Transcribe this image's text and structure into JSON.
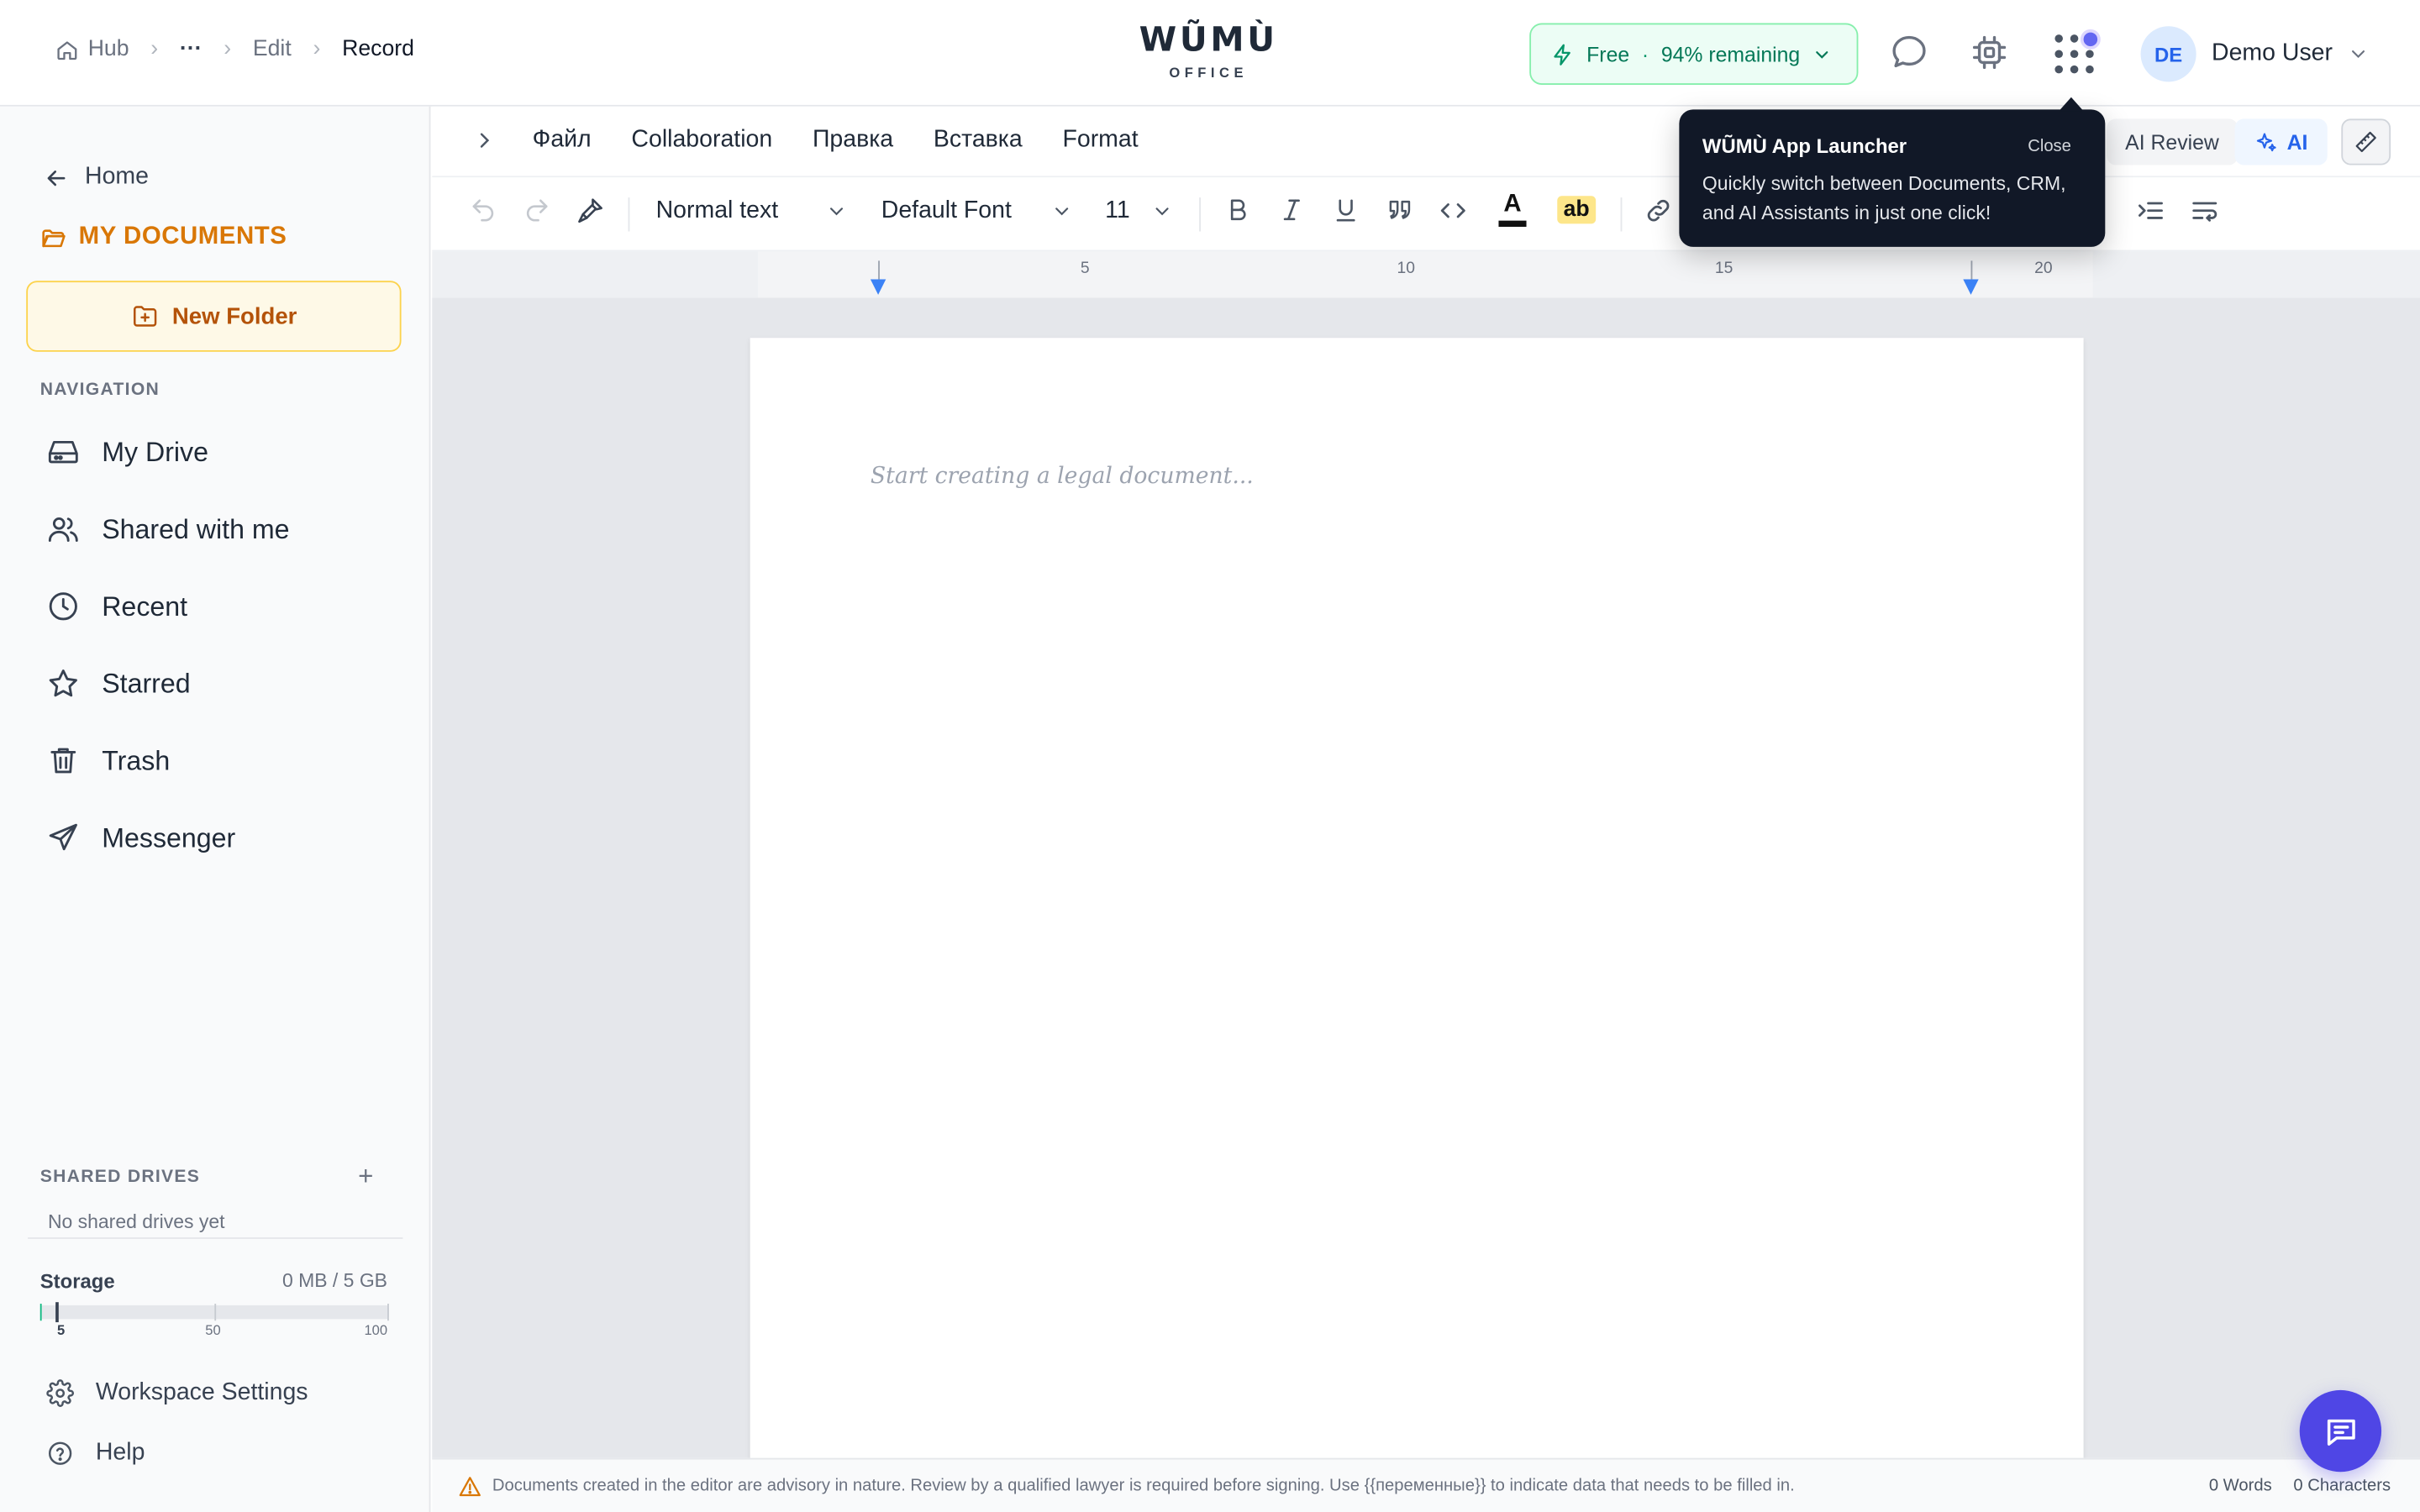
{
  "header": {
    "breadcrumbs": {
      "hub": "Hub",
      "ellipsis": "···",
      "edit": "Edit",
      "current": "Record"
    },
    "logo": {
      "word": "WŨMÙ",
      "sub": "OFFICE"
    },
    "plan": {
      "name": "Free",
      "separator": "·",
      "remaining": "94% remaining"
    },
    "user": {
      "initials": "DE",
      "name": "Demo User"
    },
    "apps_notification_color": "#6366f1"
  },
  "sidebar": {
    "home": "Home",
    "section_title": "MY DOCUMENTS",
    "new_folder": "New Folder",
    "nav_label": "NAVIGATION",
    "nav_items": [
      {
        "label": "My Drive",
        "icon": "drive-icon"
      },
      {
        "label": "Shared with me",
        "icon": "users-icon"
      },
      {
        "label": "Recent",
        "icon": "clock-icon"
      },
      {
        "label": "Starred",
        "icon": "star-icon"
      },
      {
        "label": "Trash",
        "icon": "trash-icon"
      },
      {
        "label": "Messenger",
        "icon": "send-icon"
      }
    ],
    "shared_drives_label": "SHARED DRIVES",
    "shared_drives_add": "+",
    "no_shared": "No shared drives yet",
    "storage": {
      "label": "Storage",
      "value": "0 MB / 5 GB",
      "used_fraction": 0.0,
      "scale": [
        "5",
        "50",
        "100"
      ]
    },
    "workspace_settings": "Workspace Settings",
    "help": "Help"
  },
  "menubar": {
    "items": [
      "Файл",
      "Collaboration",
      "Правка",
      "Вставка",
      "Format"
    ],
    "ai_review": "AI Review",
    "ai": "AI"
  },
  "toolbar": {
    "style": "Normal text",
    "font": "Default Font",
    "size": "11",
    "text_color_glyph": "A",
    "highlight_glyph": "ab"
  },
  "ruler": {
    "labels": [
      "5",
      "10",
      "15",
      "20"
    ]
  },
  "editor": {
    "placeholder": "Start creating a legal document..."
  },
  "popover": {
    "title": "WŨMÙ App Launcher",
    "close": "Close",
    "body": "Quickly switch between Documents, CRM, and AI Assistants in just one click!"
  },
  "footer": {
    "disclaimer": "Documents created in the editor are advisory in nature. Review by a qualified lawyer is required before signing. Use {{переменные}} to indicate data that needs to be filled in.",
    "words": "0 Words",
    "characters": "0 Characters"
  },
  "colors": {
    "accent_amber": "#d97706",
    "accent_blue": "#2563eb",
    "plan_green": "#047857",
    "fab_indigo": "#4f46e5",
    "ruler_marker": "#3b82f6"
  }
}
